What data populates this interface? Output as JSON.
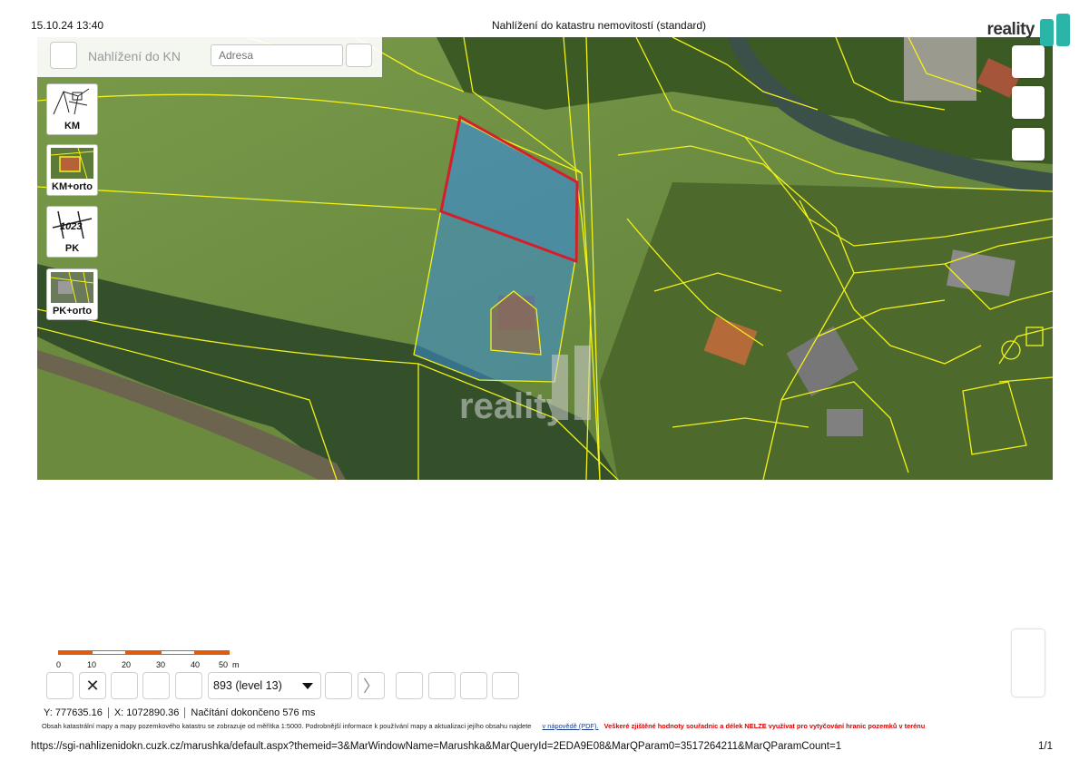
{
  "print": {
    "datetime": "15.10.24 13:40",
    "title": "Nahlížení do katastru nemovitostí (standard)",
    "url": "https://sgi-nahlizenidokn.cuzk.cz/marushka/default.aspx?themeid=3&MarWindowName=Marushka&MarQueryId=2EDA9E08&MarQParam0=3517264211&MarQParamCount=1",
    "page": "1/1"
  },
  "brand": {
    "text": "reality",
    "watermark": "reality"
  },
  "header": {
    "app_title": "Nahlížení do KN",
    "address_placeholder": "Adresa"
  },
  "layers": [
    {
      "label": "KM",
      "icon": "cadastral-map-icon"
    },
    {
      "label": "KM+orto",
      "icon": "cadastral-orto-icon"
    },
    {
      "label": "PK",
      "icon": "land-registry-icon"
    },
    {
      "label": "PK+orto",
      "icon": "land-registry-orto-icon"
    }
  ],
  "scale": {
    "labels": [
      "0",
      "10",
      "20",
      "30",
      "40",
      "50",
      "m"
    ]
  },
  "toolbar": {
    "close_glyph": "✕",
    "zoom_value": "893 (level 13)",
    "next_glyph": "〉"
  },
  "status": {
    "y": "Y: 777635.16",
    "x": "X: 1072890.36",
    "loading": "Načítání dokončeno 576 ms"
  },
  "info": {
    "text": "Obsah katastrální mapy a mapy pozemkového katastru se zobrazuje od měřítka 1:5000. Podrobnější informace k používání mapy a aktualizaci jejího obsahu najdete",
    "link": "v nápovědě (PDF).",
    "warning": "Veškeré zjištěné hodnoty souřadnic a délek NELZE využívat pro vytyčování hranic pozemků v terénu"
  },
  "colors": {
    "parcel_line": "#f2f21a",
    "selection": "#d41f2b",
    "highlight": "#3a8ed8",
    "scale_accent": "#e05a10",
    "brand_teal": "#2bb5a8",
    "warning": "#e00000"
  }
}
